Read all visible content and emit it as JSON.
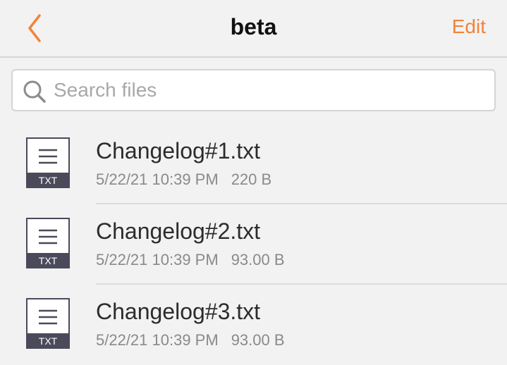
{
  "navbar": {
    "title": "beta",
    "edit_label": "Edit",
    "back_icon": "chevron-left-icon",
    "accent_color": "#f0843a"
  },
  "search": {
    "placeholder": "Search files",
    "value": "",
    "icon": "search-icon"
  },
  "files": [
    {
      "name": "Changelog#1.txt",
      "date": "5/22/21 10:39 PM",
      "size": "220 B",
      "type_label": "TXT",
      "icon": "text-file-icon"
    },
    {
      "name": "Changelog#2.txt",
      "date": "5/22/21 10:39 PM",
      "size": "93.00 B",
      "type_label": "TXT",
      "icon": "text-file-icon"
    },
    {
      "name": "Changelog#3.txt",
      "date": "5/22/21 10:39 PM",
      "size": "93.00 B",
      "type_label": "TXT",
      "icon": "text-file-icon"
    }
  ]
}
